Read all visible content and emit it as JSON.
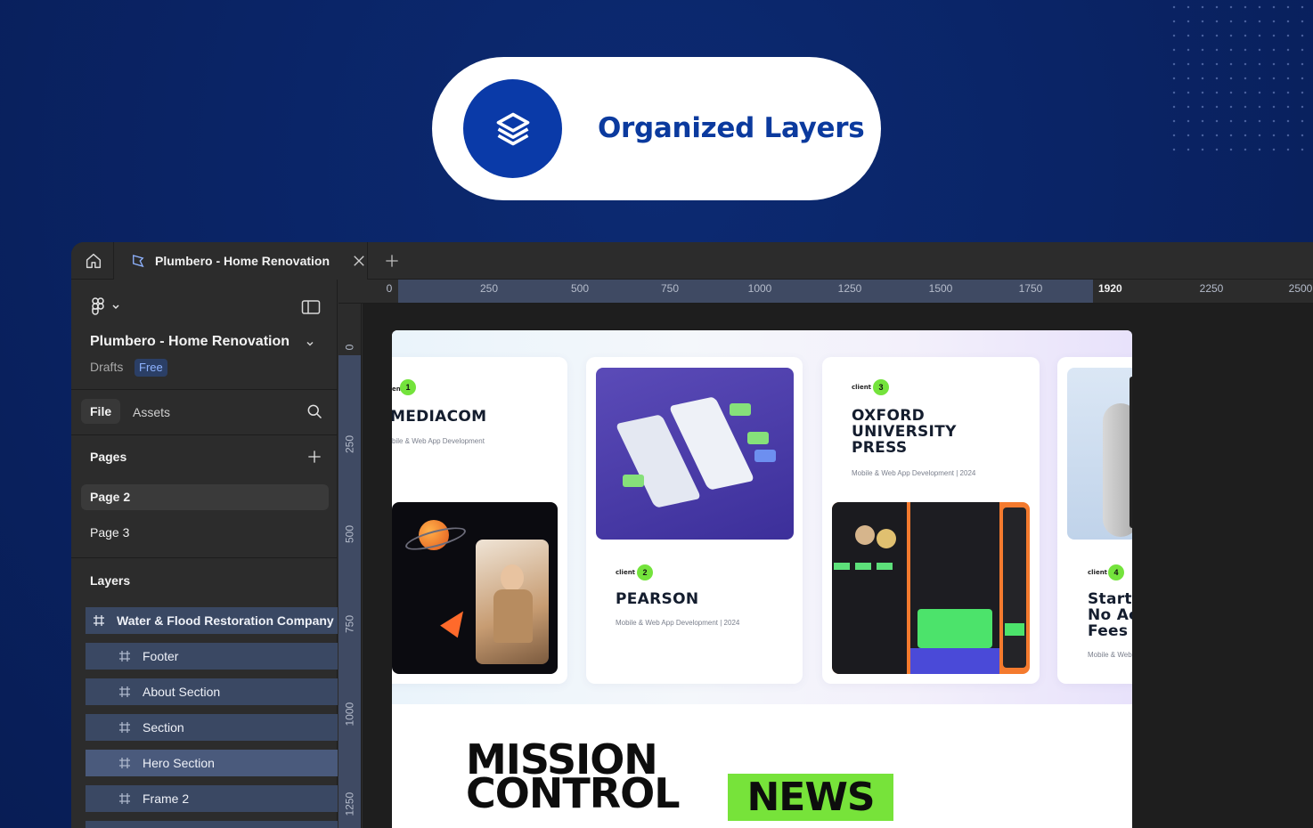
{
  "banner": {
    "title": "Organized Layers",
    "icon": "layers-icon",
    "accent": "#0a3aa8"
  },
  "tabbar": {
    "home_icon": "home-icon",
    "active_tab_title": "Plumbero - Home Renovation",
    "add_icon": "plus-icon"
  },
  "sidebar": {
    "project_name": "Plumbero - Home Renovation",
    "location": "Drafts",
    "plan_badge": "Free",
    "tabs": {
      "file": "File",
      "assets": "Assets"
    },
    "pages_heading": "Pages",
    "pages": [
      {
        "label": "Page 2",
        "active": true
      },
      {
        "label": "Page 3",
        "active": false
      }
    ],
    "layers_heading": "Layers",
    "layers": [
      {
        "label": "Water & Flood Restoration Company",
        "depth": 0,
        "selected": false
      },
      {
        "label": "Footer",
        "depth": 1,
        "selected": false
      },
      {
        "label": "About Section",
        "depth": 1,
        "selected": false
      },
      {
        "label": "Section",
        "depth": 1,
        "selected": false
      },
      {
        "label": "Hero Section",
        "depth": 1,
        "selected": true
      },
      {
        "label": "Frame 2",
        "depth": 1,
        "selected": false
      }
    ]
  },
  "rulers": {
    "top": [
      "0",
      "250",
      "500",
      "750",
      "1000",
      "1250",
      "1500",
      "1750",
      "1920",
      "2250",
      "2500"
    ],
    "left": [
      "0",
      "250",
      "500",
      "750",
      "1000",
      "1250"
    ]
  },
  "canvas": {
    "cards": [
      {
        "client_label": "ent",
        "number": "1",
        "title": "MEDIACOM",
        "subtitle": "bile & Web App Development"
      },
      {
        "client_label": "client",
        "number": "2",
        "title": "PEARSON",
        "subtitle": "Mobile & Web App Development | 2024"
      },
      {
        "client_label": "client",
        "number": "3",
        "title_lines": [
          "OXFORD",
          "UNIVERSITY",
          "PRESS"
        ],
        "subtitle": "Mobile & Web App Development | 2024"
      },
      {
        "client_label": "client",
        "number": "4",
        "title_lines": [
          "Start",
          "No Ac",
          "Fees"
        ],
        "subtitle": "Mobile & Web"
      }
    ],
    "headline_line1": "MISSION",
    "headline_line2": "CONTROL",
    "headline_badge": "NEWS",
    "badge_color": "#77e33a"
  }
}
